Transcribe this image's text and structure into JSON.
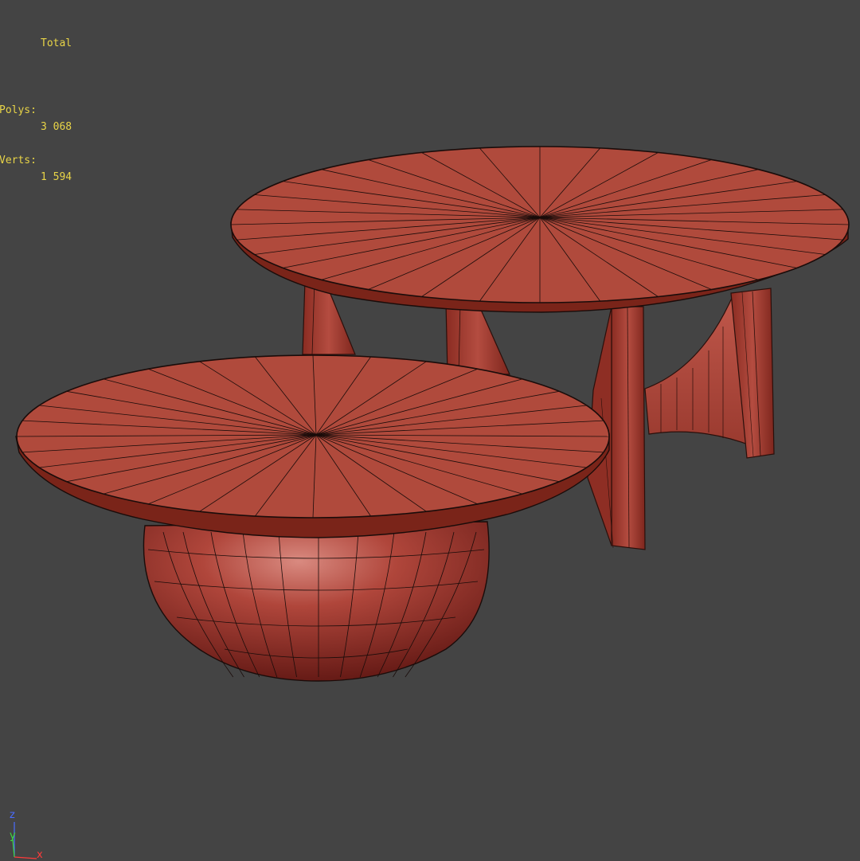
{
  "stats": {
    "header": "Total",
    "polys_label": "Polys:",
    "polys_value": "3 068",
    "verts_label": "Verts:",
    "verts_value": "1 594"
  },
  "axis_gizmo": {
    "z_label": "z",
    "y_label": "y",
    "x_label": "x"
  },
  "colors": {
    "viewport_background": "#444444",
    "stats_text": "#e8d447",
    "model_fill": "#b04a3c",
    "wire": "#1a0c0a",
    "axis_x": "#ff3a3a",
    "axis_y": "#3ddc3d",
    "axis_z": "#4a6cff"
  },
  "models": [
    {
      "name": "round-coffee-table-large",
      "base": "three panel legs"
    },
    {
      "name": "round-coffee-table-small",
      "base": "spherical bowl base"
    }
  ]
}
